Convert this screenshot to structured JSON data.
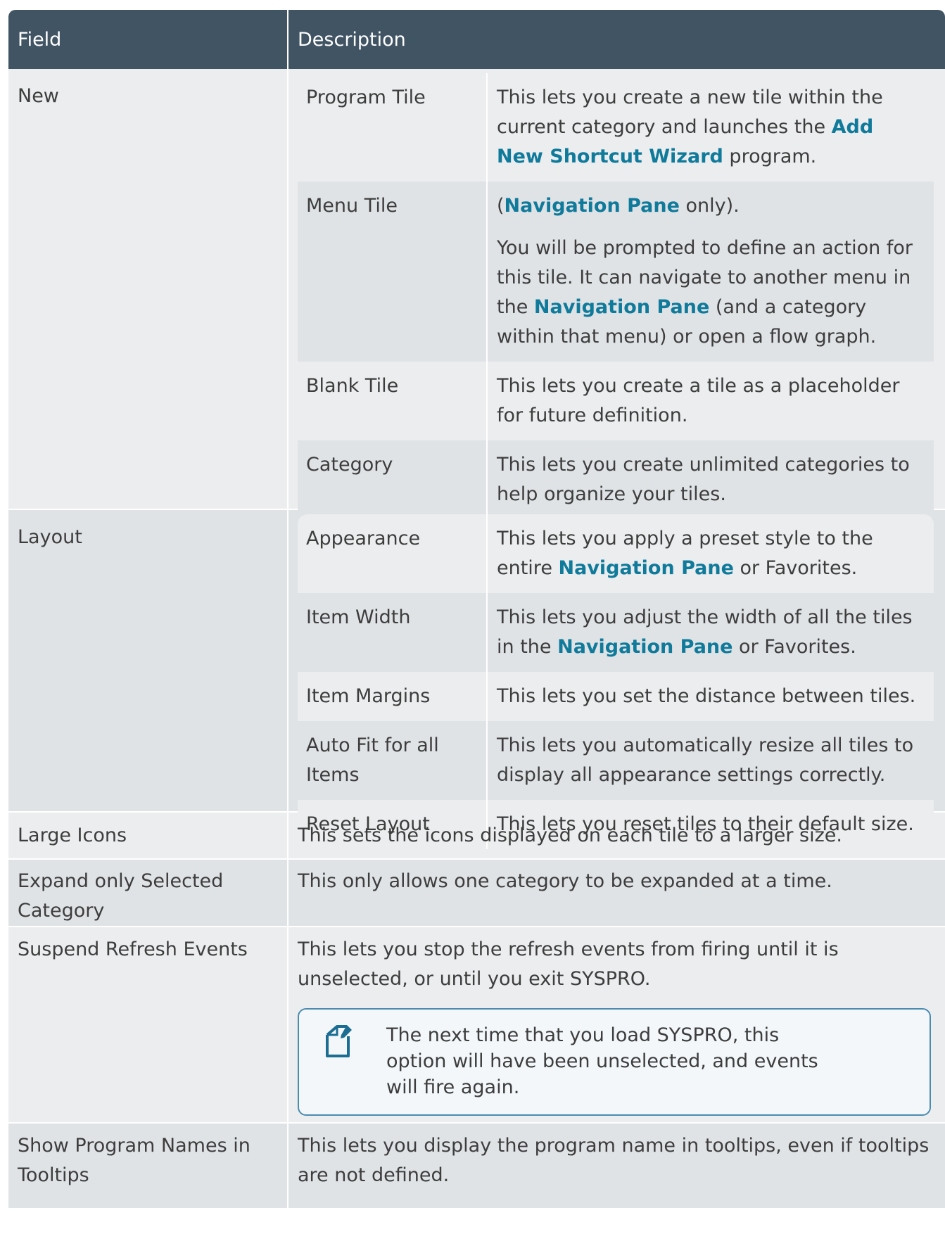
{
  "header": {
    "field": "Field",
    "description": "Description"
  },
  "rows": {
    "new": {
      "field": "New",
      "items": {
        "program_tile": {
          "name": "Program Tile",
          "t1": "This lets you create a new tile within the current category and launches the ",
          "link": "Add New Shortcut Wizard",
          "t2": " program."
        },
        "menu_tile": {
          "name": "Menu Tile",
          "p1_open": "(",
          "p1_link": "Navigation Pane",
          "p1_close": " only).",
          "p2_t1": "You will be prompted to define an action for this tile. It can navigate to another menu in the ",
          "p2_link": "Navigation Pane",
          "p2_t2": " (and a category within that menu) or open a flow graph."
        },
        "blank_tile": {
          "name": "Blank Tile",
          "desc": "This lets you create a tile as a placeholder for future definition."
        },
        "category": {
          "name": "Category",
          "desc": "This lets you create unlimited categories to help organize your tiles."
        }
      }
    },
    "layout": {
      "field": "Layout",
      "items": {
        "appearance": {
          "name": "Appearance",
          "t1": "This lets you apply a preset style to the entire ",
          "link": "Navigation Pane",
          "t2": " or Favorites."
        },
        "item_width": {
          "name": "Item Width",
          "t1": "This lets you adjust the width of all the tiles in the ",
          "link": "Navigation Pane",
          "t2": " or Favorites."
        },
        "item_margins": {
          "name": "Item Margins",
          "desc": "This lets you set the distance between tiles."
        },
        "auto_fit": {
          "name": "Auto Fit for all Items",
          "desc": "This lets you automatically resize all tiles to display all appearance settings correctly."
        },
        "reset_layout": {
          "name": "Reset Layout",
          "desc": "This lets you reset tiles to their default size."
        }
      }
    },
    "large_icons": {
      "field": "Large Icons",
      "desc": "This sets the icons displayed on each tile to a larger size."
    },
    "expand_only": {
      "field": "Expand only Selected Category",
      "desc": "This only allows one category to be expanded at a time."
    },
    "suspend_refresh": {
      "field": "Suspend Refresh Events",
      "desc": "This lets you stop the refresh events from firing until it is unselected, or until you exit SYSPRO.",
      "note": "The next time that you load SYSPRO, this option will have been unselected, and events will fire again.",
      "note_icon": "note-edit-icon"
    },
    "show_program_names": {
      "field": "Show Program Names in Tooltips",
      "desc": "This lets you display the program name in tooltips, even if tooltips are not defined."
    }
  },
  "colors": {
    "header_bg": "#415464",
    "row_light": "#ebedef",
    "row_dark": "#e0e3e6",
    "link": "#107a9b",
    "note_border": "#4a8bb0"
  }
}
